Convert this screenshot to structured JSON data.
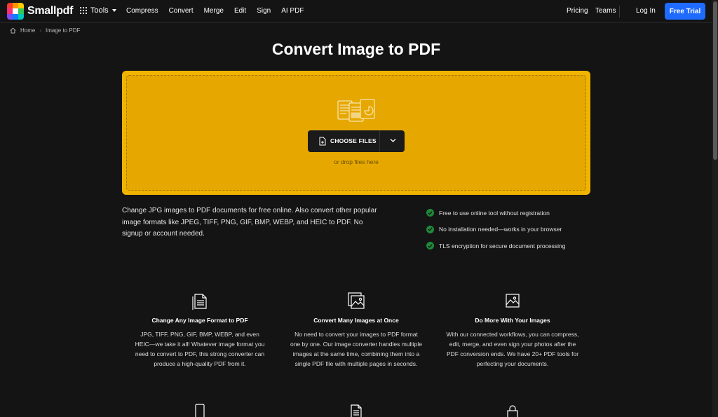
{
  "nav": {
    "brand": "Smallpdf",
    "tools_label": "Tools",
    "links": [
      "Compress",
      "Convert",
      "Merge",
      "Edit",
      "Sign",
      "AI PDF"
    ],
    "pricing": "Pricing",
    "teams": "Teams",
    "login": "Log In",
    "trial": "Free Trial",
    "trial_color": "#1f6bff"
  },
  "breadcrumb": {
    "home": "Home",
    "current": "Image to PDF"
  },
  "page_title": "Convert Image to PDF",
  "dropzone": {
    "button_label": "CHOOSE FILES",
    "hint": "or drop files here",
    "accent_color": "#f0b400"
  },
  "description": "Change JPG images to PDF documents for free online. Also convert other popular image formats like JPEG, TIFF, PNG, GIF, BMP, WEBP, and HEIC to PDF. No signup or account needed.",
  "features": [
    "Free to use online tool without registration",
    "No installation needed—works in your browser",
    "TLS encryption for secure document processing"
  ],
  "cards": [
    {
      "icon": "document-stack-icon",
      "title": "Change Any Image Format to PDF",
      "body": "JPG, TIFF, PNG, GIF, BMP, WEBP, and even HEIC—we take it all! Whatever image format you need to convert to PDF, this strong converter can produce a high-quality PDF from it."
    },
    {
      "icon": "image-stack-icon",
      "title": "Convert Many Images at Once",
      "body": "No need to convert your images to PDF format one by one. Our image converter handles multiple images at the same time, combining them into a single PDF file with multiple pages in seconds."
    },
    {
      "icon": "image-icon",
      "title": "Do More With Your Images",
      "body": "With our connected workflows, you can compress, edit, merge, and even sign your photos after the PDF conversion ends. We have 20+ PDF tools for perfecting your documents."
    }
  ],
  "next_row_icons": [
    "phone-icon",
    "document-icon",
    "lock-icon"
  ]
}
